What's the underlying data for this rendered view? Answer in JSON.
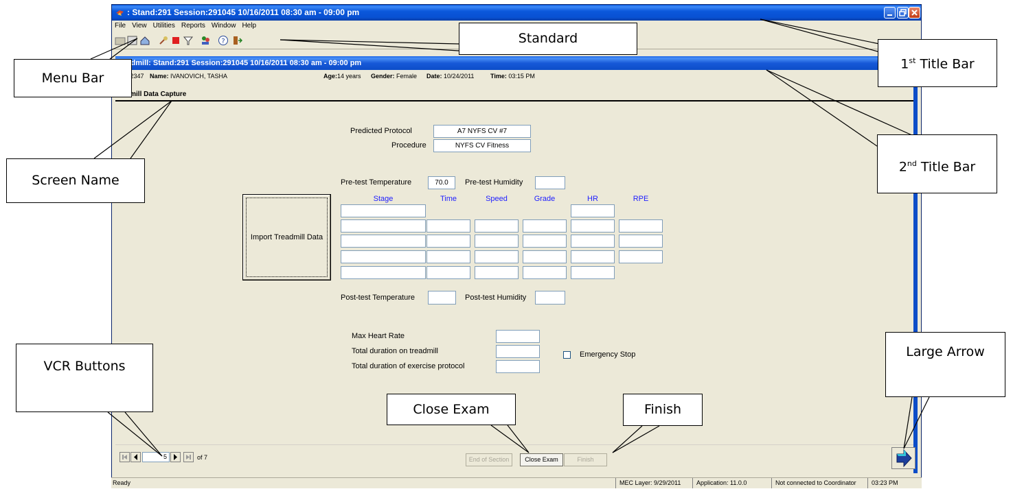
{
  "window": {
    "title": ": Stand:291 Session:291045 10/16/2011 08:30 am - 09:00 pm",
    "menu": [
      "File",
      "View",
      "Utilities",
      "Reports",
      "Window",
      "Help"
    ]
  },
  "toolbar_icons": [
    "open-icon",
    "save-icon",
    "home-icon",
    "tool-icon",
    "stop-icon",
    "filter-icon",
    "people-icon",
    "help-icon",
    "exit-icon"
  ],
  "inner_window": {
    "title": "readmill: Stand:291 Session:291045 10/16/2011 08:30 am - 09:00 pm",
    "info": {
      "id_label": "D:",
      "id_value": "572347",
      "name_label": "Name:",
      "name_value": "IVANOVICH, TASHA",
      "age_label": "Age:",
      "age_value": "14 years",
      "gender_label": "Gender:",
      "gender_value": "Female",
      "date_label": "Date:",
      "date_value": "10/24/2011",
      "time_label": "Time:",
      "time_value": "03:15 PM"
    },
    "screen_name": "readmill Data Capture"
  },
  "form": {
    "predicted_protocol_label": "Predicted Protocol",
    "predicted_protocol_value": "A7 NYFS CV #7",
    "procedure_label": "Procedure",
    "procedure_value": "NYFS CV Fitness",
    "pre_temp_label": "Pre-test Temperature",
    "pre_temp_value": "70.0",
    "pre_humidity_label": "Pre-test Humidity",
    "pre_humidity_value": "",
    "import_button": "Import Treadmill Data",
    "columns": [
      "Stage",
      "Time",
      "Speed",
      "Grade",
      "HR",
      "RPE"
    ],
    "post_temp_label": "Post-test Temperature",
    "post_temp_value": "",
    "post_humidity_label": "Post-test Humidity",
    "post_humidity_value": "",
    "max_hr_label": "Max Heart Rate",
    "total_treadmill_label": "Total duration on treadmill",
    "total_protocol_label": "Total duration of exercise protocol",
    "emergency_stop_label": "Emergency Stop"
  },
  "navigation": {
    "page_value": "5",
    "of_text": "of 7",
    "end_of_section": "End of Section",
    "close_exam": "Close Exam",
    "finish": "Finish"
  },
  "status": {
    "ready": "Ready",
    "mec_layer": "MEC Layer: 9/29/2011",
    "application": "Application: 11.0.0",
    "connection": "Not connected to Coordinator",
    "clock": "03:23 PM"
  },
  "callouts": {
    "standard": "Standard",
    "first_title_bar": "1",
    "first_sup": "st",
    "first_rest": " Title Bar",
    "menu_bar": "Menu Bar",
    "second_title_bar": "2",
    "second_sup": "nd",
    "second_rest": " Title Bar",
    "screen_name": "Screen Name",
    "vcr_buttons": "VCR Buttons",
    "large_arrow": "Large Arrow",
    "close_exam": "Close Exam",
    "finish": "Finish"
  },
  "colors": {
    "titlebar_blue": "#0850d2",
    "window_bg": "#ece9d8",
    "header_blue": "#2020ff"
  }
}
